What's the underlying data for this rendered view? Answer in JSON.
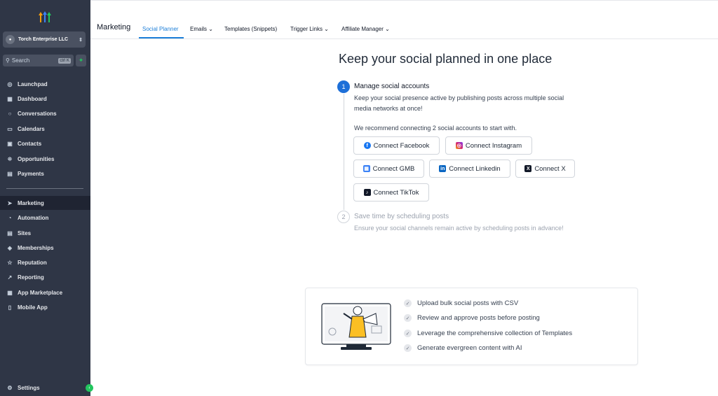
{
  "sidebar": {
    "account_name": "Torch Enterprise LLC",
    "search_placeholder": "Search",
    "search_shortcut": "ctrl K",
    "nav_items": [
      {
        "label": "Launchpad",
        "icon": "rocket-icon"
      },
      {
        "label": "Dashboard",
        "icon": "grid-icon"
      },
      {
        "label": "Conversations",
        "icon": "chat-icon"
      },
      {
        "label": "Calendars",
        "icon": "calendar-icon"
      },
      {
        "label": "Contacts",
        "icon": "contact-icon"
      },
      {
        "label": "Opportunities",
        "icon": "funnel-icon"
      },
      {
        "label": "Payments",
        "icon": "payment-icon"
      },
      {
        "label": "Marketing",
        "icon": "send-icon",
        "active": true
      },
      {
        "label": "Automation",
        "icon": "automation-icon"
      },
      {
        "label": "Sites",
        "icon": "sites-icon"
      },
      {
        "label": "Memberships",
        "icon": "badge-icon"
      },
      {
        "label": "Reputation",
        "icon": "star-icon"
      },
      {
        "label": "Reporting",
        "icon": "trend-icon"
      },
      {
        "label": "App Marketplace",
        "icon": "apps-icon"
      },
      {
        "label": "Mobile App",
        "icon": "phone-icon"
      }
    ],
    "settings_label": "Settings"
  },
  "topbar": {
    "title": "Marketing",
    "tabs": [
      {
        "label": "Social Planner"
      },
      {
        "label": "Emails ⌄"
      },
      {
        "label": "Templates (Snippets)"
      },
      {
        "label": "Trigger Links ⌄"
      },
      {
        "label": "Affiliate Manager ⌄"
      }
    ]
  },
  "main": {
    "heading": "Keep your social planned in one place",
    "step1": {
      "number": "1",
      "title": "Manage social accounts",
      "desc_line1": "Keep your social presence active by publishing posts across multiple social",
      "desc_line2": "media networks at once!",
      "recommend": "We recommend connecting 2 social accounts to start with."
    },
    "buttons": {
      "facebook": "Connect Facebook",
      "instagram": "Connect Instagram",
      "gmb": "Connect GMB",
      "linkedin": "Connect Linkedin",
      "x": "Connect X",
      "tiktok": "Connect TikTok"
    },
    "step2": {
      "number": "2",
      "title": "Save time by scheduling posts",
      "desc": "Ensure your social channels remain active by scheduling posts in advance!"
    },
    "features": [
      "Upload bulk social posts with CSV",
      "Review and approve posts before posting",
      "Leverage the comprehensive collection of Templates",
      "Generate evergreen content with AI"
    ]
  },
  "colors": {
    "sidebar_bg": "#2f3646",
    "accent": "#1d7fd8",
    "facebook": "#1877f2",
    "instagram": "#d62976",
    "linkedin": "#0a66c2"
  }
}
